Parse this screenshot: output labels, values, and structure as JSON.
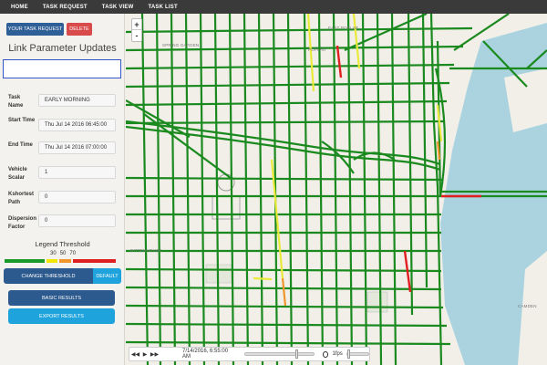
{
  "nav": {
    "items": [
      "HOME",
      "TASK REQUEST",
      "TASK VIEW",
      "TASK LIST"
    ]
  },
  "sidebar": {
    "task_request_button": "YOUR TASK REQUEST",
    "delete_button": "DELETE",
    "title": "Link Parameter Updates",
    "title_input_value": "",
    "fields": {
      "task_name": {
        "label": "Task Name",
        "value": "EARLY MORNING"
      },
      "start_time": {
        "label": "Start Time",
        "value": "Thu Jul 14 2016 06:45:00"
      },
      "end_time": {
        "label": "End Time",
        "value": "Thu Jul 14 2016 07:00:00"
      },
      "vehicle_scalar": {
        "label": "Vehicle Scalar",
        "value": "1"
      },
      "kshortest_path": {
        "label": "Kshortest Path",
        "value": "0"
      },
      "dispersion_factor": {
        "label": "Dispersion Factor",
        "value": "0"
      }
    },
    "legend": {
      "title": "Legend Threshold",
      "thresholds": [
        "30",
        "50",
        "70"
      ],
      "colors": [
        "#1a9a2a",
        "#f2e600",
        "#f0952a",
        "#e02020"
      ]
    },
    "change_threshold_button": "CHANGE THRESHOLD",
    "default_button": "DEFAULT",
    "basic_results_button": "BASIC RESULTS",
    "export_results_button": "EXPORT RESULTS"
  },
  "map": {
    "zoom_in": "+",
    "zoom_out": "-",
    "labels": {
      "spring_garden": "SPRING GARDEN",
      "poplar": "POPLAR",
      "east_poplar": "EAST POPLAR",
      "rittenhouse": "RITTENHOUSE",
      "camden": "CAMDEN"
    },
    "road_colors": {
      "green": "#1a8a1f",
      "yellow": "#eaea3a",
      "orange": "#f0952a",
      "red": "#e02020",
      "river": "#aad3df"
    }
  },
  "player": {
    "rewind_icon": "◀◀",
    "play_icon": "▶",
    "forward_icon": "▶▶",
    "timestamp": "7/14/2016, 6:55:00 AM",
    "fps_label": "1fps"
  }
}
